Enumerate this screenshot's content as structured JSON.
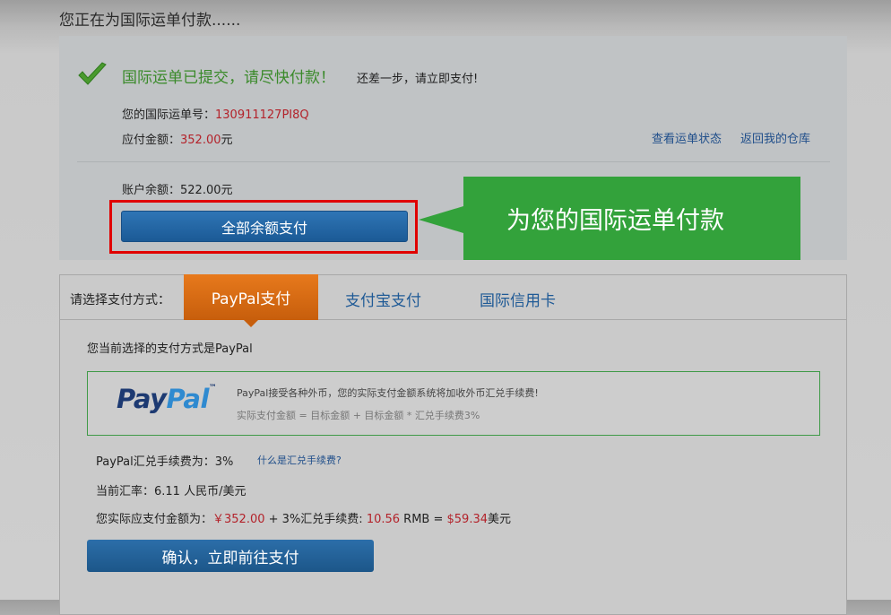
{
  "page": {
    "title": "您正在为国际运单付款......"
  },
  "status": {
    "headline": "国际运单已提交，请尽快付款！",
    "subline": "还差一步，请立即支付!",
    "order_label": "您的国际运单号：",
    "order_number": "130911127PI8Q",
    "amount_label": "应付金额：",
    "amount_value": "352.00",
    "amount_unit": "元",
    "balance_label": "账户余额：",
    "balance_value": "522.00元",
    "links": {
      "view_status": "查看运单状态",
      "back_warehouse": "返回我的仓库"
    },
    "pay_all_button": "全部余额支付",
    "callout_text": "为您的国际运单付款"
  },
  "payment": {
    "method_label": "请选择支付方式：",
    "tabs": [
      {
        "label": "PayPal支付",
        "active": true
      },
      {
        "label": "支付宝支付",
        "active": false
      },
      {
        "label": "国际信用卡",
        "active": false
      }
    ],
    "selected_text": "您当前选择的支付方式是PayPal",
    "paypal_logo": {
      "part1": "Pay",
      "part2": "Pal",
      "tm": "™"
    },
    "paypal_note1": "PayPal接受各种外币，您的实际支付金额系统将加收外币汇兑手续费!",
    "paypal_note2": "实际支付金额 = 目标金额 + 目标金额 * 汇兑手续费3%",
    "fee_label": "PayPal汇兑手续费为：3%",
    "fee_link": "什么是汇兑手续费?",
    "rate_label": "当前汇率：6.11 人民币/美元",
    "total": {
      "label": "您实际应支付金额为：",
      "rmb": "￥352.00",
      "plus_text": " + 3%汇兑手续费: ",
      "fee": "10.56",
      "rmb_unit": " RMB = ",
      "usd": "$59.34",
      "usd_unit": "美元"
    },
    "confirm_button": "确认，立即前往支付"
  },
  "colors": {
    "green": "#3a8a2a",
    "callout": "#33a23b",
    "red_border": "#e00000",
    "orange_tab": "#e7791c",
    "blue_button": "#1b5a96"
  },
  "icons": {
    "check": "check-icon"
  }
}
